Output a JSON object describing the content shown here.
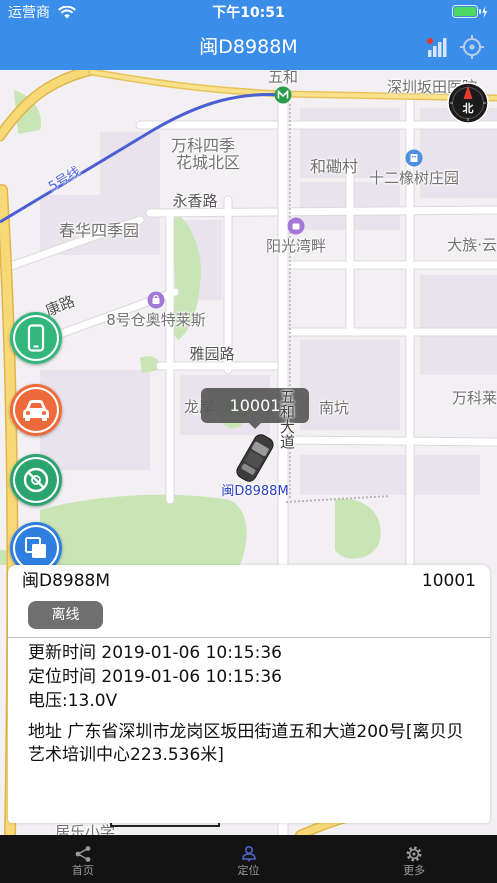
{
  "status_bar": {
    "carrier": "运营商",
    "time": "下午10:51",
    "battery_level": 1.0,
    "icons": [
      "wifi-icon",
      "battery-icon",
      "charging-bolt-icon"
    ]
  },
  "nav": {
    "title": "闽D8988M",
    "icons": [
      "signal-icon",
      "locate-icon"
    ]
  },
  "map": {
    "labels": [
      "五和",
      "深圳坂田医院",
      "万科四季",
      "花城北区",
      "和磡村",
      "十二橡树庄园",
      "永香路",
      "春华四季园",
      "阳光湾畔",
      "大族·云",
      "8号仓奥特莱斯",
      "康路",
      "雅园路",
      "龙岸",
      "南坑",
      "万科莱",
      "居乐小学"
    ],
    "metro_line": "5号线",
    "road_name": "五和大道",
    "compass": "北",
    "buttons": [
      "phone-icon",
      "car-icon",
      "no-entry-icon",
      "layers-icon"
    ]
  },
  "marker": {
    "plate": "闽D8988M",
    "callout": "10001",
    "icon": "car-top-view-icon"
  },
  "card": {
    "plate": "闽D8988M",
    "device_id": "10001",
    "status": "离线",
    "update_time": "更新时间 2019-01-06 10:15:36",
    "locate_time": "定位时间 2019-01-06 10:15:36",
    "voltage": "电压:13.0V",
    "address": "地址 广东省深圳市龙岗区坂田街道五和大道200号[离贝贝艺术培训中心223.536米]"
  },
  "tabs": [
    {
      "label": "首页",
      "icon": "share-icon",
      "active": false
    },
    {
      "label": "定位",
      "icon": "person-pin-icon",
      "active": true
    },
    {
      "label": "更多",
      "icon": "gear-icon",
      "active": false
    }
  ],
  "colors": {
    "nav_bar": "#3b8dea",
    "tab_bar": "#131313",
    "plate_label": "#2a3fc7",
    "status_badge": "#6f6f6f",
    "battery": "#4cd964",
    "active_tab_icon": "#4e64c8"
  }
}
